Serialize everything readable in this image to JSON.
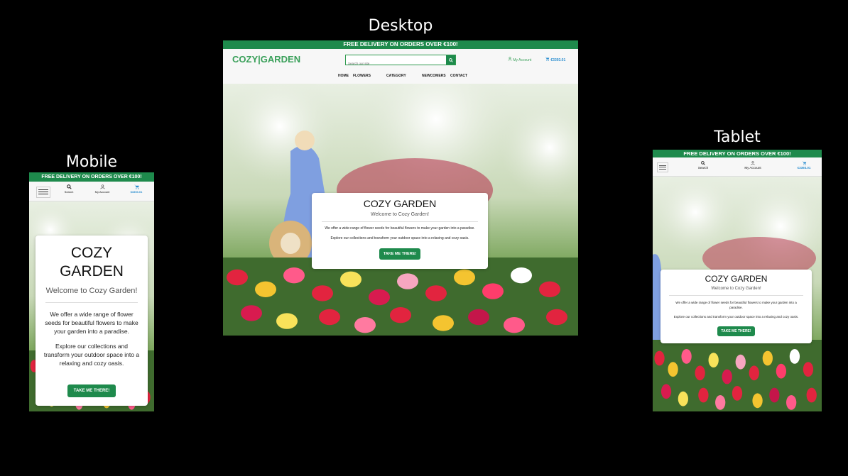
{
  "captions": {
    "desktop": "Desktop",
    "tablet": "Tablet",
    "mobile": "Mobile"
  },
  "banner": "FREE DELIVERY ON ORDERS OVER €100!",
  "logo": "COZY|GARDEN",
  "search": {
    "placeholder": "Search our site",
    "label": "Search"
  },
  "account": "My Account",
  "cart_total": "€3393.01",
  "cart_total_small": "$3393.01",
  "nav": [
    "HOME",
    "FLOWERS",
    "CATEGORY",
    "NEWCOMERS",
    "CONTACT"
  ],
  "hero": {
    "title": "COZY GARDEN",
    "welcome": "Welcome to Cozy Garden!",
    "p1": "We offer a wide range of flower seeds for beautiful flowers to make your garden into a paradise.",
    "p2": "Explore our collections and transform your outdoor space into a relaxing and cozy oasis.",
    "cta": "TAKE ME THERE!"
  },
  "colors": {
    "brand": "#1e8a4c",
    "logo": "#3aa05a",
    "cart": "#2d8fd0"
  },
  "icons": [
    "search-icon",
    "user-icon",
    "cart-icon",
    "hamburger-icon"
  ]
}
